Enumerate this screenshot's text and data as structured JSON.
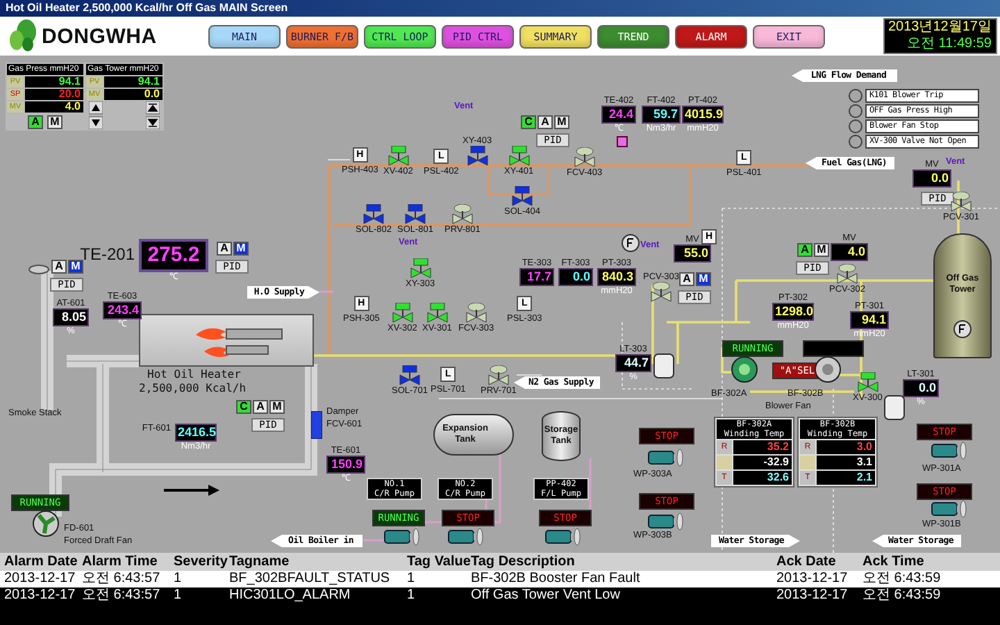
{
  "window": {
    "title": "Hot Oil Heater 2,500,000 Kcal/hr  Off Gas MAIN Screen"
  },
  "header": {
    "logo": "DONGWHA",
    "date": "2013년12월17일",
    "time": "오전 11:49:59",
    "nav": [
      {
        "label": "MAIN",
        "color": "#a8d8f8"
      },
      {
        "label": "BURNER F/B",
        "color": "#f07030"
      },
      {
        "label": "CTRL LOOP",
        "color": "#50e850"
      },
      {
        "label": "PID CTRL",
        "color": "#e050e0"
      },
      {
        "label": "SUMMARY",
        "color": "#f0e060"
      },
      {
        "label": "TREND",
        "color": "#3c8c30"
      },
      {
        "label": "ALARM",
        "color": "#c01818"
      },
      {
        "label": "EXIT",
        "color": "#f8b8d8"
      }
    ]
  },
  "faceplates": [
    {
      "title": "Gas Press",
      "unit": "mmH20",
      "rows": [
        {
          "label": "PV",
          "value": "94.1",
          "kind": "pv"
        },
        {
          "label": "SP",
          "value": "20.0",
          "kind": "sp"
        },
        {
          "label": "MV",
          "value": "4.0",
          "kind": "mv"
        }
      ],
      "modes": [
        {
          "label": "A",
          "selected": true
        },
        {
          "label": "M",
          "selected": false
        }
      ]
    },
    {
      "title": "Gas Tower",
      "unit": "mmH20",
      "rows": [
        {
          "label": "PV",
          "value": "94.1",
          "kind": "pv"
        },
        {
          "label": "MV",
          "value": "0.0",
          "kind": "mv"
        }
      ]
    }
  ],
  "diagram": {
    "readouts": [
      {
        "tag": "TE-402",
        "value": "24.4",
        "unit": "℃",
        "kind": "temperature"
      },
      {
        "tag": "FT-402",
        "value": "59.7",
        "unit": "Nm3/hr",
        "kind": "flow"
      },
      {
        "tag": "PT-402",
        "value": "4015.9",
        "unit": "mmH20",
        "kind": "pressure"
      },
      {
        "tag": "MV",
        "value": "0.0",
        "kind": "output"
      },
      {
        "tag": "MV",
        "value": "55.0",
        "kind": "output"
      },
      {
        "tag": "TE-303",
        "value": "17.7",
        "kind": "temperature"
      },
      {
        "tag": "FT-303",
        "value": "0.0",
        "kind": "flow"
      },
      {
        "tag": "PT-303",
        "value": "840.3",
        "unit": "mmH20",
        "kind": "pressure"
      },
      {
        "tag": "MV",
        "value": "4.0",
        "kind": "output"
      },
      {
        "tag": "PT-302",
        "value": "1298.0",
        "unit": "mmH20",
        "kind": "pressure"
      },
      {
        "tag": "PT-301",
        "value": "94.1",
        "unit": "mmH20",
        "kind": "pressure"
      },
      {
        "tag": "LT-303",
        "value": "44.7",
        "unit": "%",
        "kind": "level"
      },
      {
        "tag": "LT-301",
        "value": "0.0",
        "unit": "%",
        "kind": "level"
      },
      {
        "tag": "TE-201",
        "value": "275.2",
        "unit": "℃",
        "kind": "temperature"
      },
      {
        "tag": "AT-601",
        "value": "8.05",
        "unit": "%",
        "kind": "analyzer"
      },
      {
        "tag": "TE-603",
        "value": "243.4",
        "unit": "℃",
        "kind": "temperature"
      },
      {
        "tag": "FT-601",
        "value": "2416.5",
        "unit": "Nm3/hr",
        "kind": "flow"
      },
      {
        "tag": "TE-601",
        "value": "150.9",
        "unit": "℃",
        "kind": "temperature"
      }
    ],
    "mode_groups": [
      {
        "buttons": [
          {
            "label": "C",
            "selected": true
          },
          {
            "label": "A",
            "selected": false
          },
          {
            "label": "M",
            "selected": false
          }
        ],
        "pid": "PID"
      },
      {
        "buttons": [
          {
            "label": "A",
            "selected": true
          },
          {
            "label": "M",
            "selected": false
          }
        ],
        "pid": "PID"
      },
      {
        "buttons": [
          {
            "label": "A",
            "selected": false
          },
          {
            "label": "M",
            "selected": true
          }
        ],
        "pid": "PID"
      },
      {
        "buttons": [
          {
            "label": "A",
            "selected": false
          },
          {
            "label": "M",
            "selected": true
          }
        ],
        "pid": "PID"
      },
      {
        "buttons": [
          {
            "label": "A",
            "selected": false
          },
          {
            "label": "M",
            "selected": true
          }
        ],
        "pid": "PID"
      },
      {
        "buttons": [
          {
            "label": "C",
            "selected": true
          },
          {
            "label": "A",
            "selected": false
          },
          {
            "label": "M",
            "selected": false
          }
        ],
        "pid": "PID"
      },
      {
        "pid": "PID"
      }
    ],
    "lamps": [
      {
        "label": "RUNNING",
        "kind": "running"
      },
      {
        "label": "\"A\"SEL",
        "kind": "select"
      },
      {
        "label": "STOP",
        "kind": "stop"
      },
      {
        "label": "STOP",
        "kind": "stop"
      },
      {
        "label": "STOP",
        "kind": "stop"
      },
      {
        "label": "STOP",
        "kind": "stop"
      },
      {
        "label": "RUNNING",
        "kind": "running"
      },
      {
        "label": "RUNNING",
        "kind": "running"
      },
      {
        "label": "STOP",
        "kind": "stop"
      },
      {
        "label": "STOP",
        "kind": "stop"
      }
    ],
    "callouts": [
      {
        "label": "LNG Flow Demand",
        "kind": "left"
      },
      {
        "label": "Fuel Gas(LNG)",
        "kind": "left"
      },
      {
        "label": "H.O Supply",
        "kind": "right"
      },
      {
        "label": "N2 Gas Supply",
        "kind": "left"
      },
      {
        "label": "Oil Boiler in",
        "kind": "left"
      },
      {
        "label": "Water Storage",
        "kind": "right"
      },
      {
        "label": "Water Storage",
        "kind": "left"
      }
    ],
    "interlocks": [
      {
        "label": "K101 Blower Trip",
        "active": false
      },
      {
        "label": "OFF Gas Press High",
        "active": false
      },
      {
        "label": "Blower Fan Stop",
        "active": false
      },
      {
        "label": "XV-300 Valve Not Open",
        "active": false
      }
    ],
    "switches": [
      {
        "letter": "H",
        "tag": "PSH-403"
      },
      {
        "letter": "L",
        "tag": "PSL-402"
      },
      {
        "letter": "L",
        "tag": "PSL-401"
      },
      {
        "letter": "H"
      },
      {
        "letter": "H",
        "tag": "PSH-305"
      },
      {
        "letter": "L",
        "tag": "PSL-303"
      },
      {
        "letter": "L",
        "tag": "PSL-701"
      }
    ],
    "on_off_valves": [
      {
        "tag": "XY-403",
        "open": false
      },
      {
        "tag": "XV-402",
        "open": true
      },
      {
        "tag": "XY-401",
        "open": true
      },
      {
        "tag": "SOL-404",
        "open": false
      },
      {
        "tag": "SOL-802",
        "open": false
      },
      {
        "tag": "SOL-801",
        "open": false
      },
      {
        "tag": "XY-303",
        "open": true
      },
      {
        "tag": "XV-302",
        "open": true
      },
      {
        "tag": "XV-301",
        "open": true
      },
      {
        "tag": "SOL-701",
        "open": false
      },
      {
        "tag": "XV-300",
        "open": true
      }
    ],
    "control_valves": [
      {
        "tag": "FCV-403"
      },
      {
        "tag": "PRV-801"
      },
      {
        "tag": "PCV-301"
      },
      {
        "tag": "PCV-303"
      },
      {
        "tag": "PCV-302"
      },
      {
        "tag": "FCV-303"
      },
      {
        "tag": "PRV-701"
      }
    ],
    "labels": [
      {
        "text": "Vent",
        "kind": "vent"
      },
      {
        "text": "Vent",
        "kind": "vent"
      },
      {
        "text": "Vent",
        "kind": "vent"
      },
      {
        "text": "Vent",
        "kind": "vent"
      },
      {
        "text": "BF-302A",
        "kind": "tag"
      },
      {
        "text": "BF-302B",
        "kind": "tag"
      },
      {
        "text": "Blower Fan",
        "kind": "tag"
      },
      {
        "text": "WP-303A",
        "kind": "tag"
      },
      {
        "text": "WP-303B",
        "kind": "tag"
      },
      {
        "text": "WP-301A",
        "kind": "tag"
      },
      {
        "text": "WP-301B",
        "kind": "tag"
      },
      {
        "text": "Smoke Stack",
        "kind": "tag"
      },
      {
        "text": "Damper",
        "kind": "tag"
      },
      {
        "text": "FCV-601",
        "kind": "tag"
      },
      {
        "text": "FD-601",
        "kind": "tag"
      },
      {
        "text": "Forced Draft Fan",
        "kind": "tag"
      }
    ],
    "pump_labels": [
      {
        "lines": [
          "NO.1",
          "C/R Pump"
        ]
      },
      {
        "lines": [
          "NO.2",
          "C/R Pump"
        ]
      },
      {
        "lines": [
          "PP-402",
          "F/L Pump"
        ]
      }
    ],
    "heater": {
      "name": "Hot Oil Heater",
      "capacity": "2,500,000 Kcal/h"
    },
    "tanks": [
      {
        "kind": "expansion",
        "label": "Expansion Tank"
      },
      {
        "kind": "storage",
        "label": "Storage Tank"
      },
      {
        "kind": "tower",
        "label": "Off Gas Tower"
      }
    ],
    "winding_tables": [
      {
        "title": [
          "BF-302A",
          "Winding Temp"
        ],
        "rows": [
          {
            "label": "R",
            "value": "35.2",
            "kind": "r"
          },
          {
            "value": "-32.9",
            "kind": "s"
          },
          {
            "label": "T",
            "value": "32.6",
            "kind": "t"
          }
        ]
      },
      {
        "title": [
          "BF-302B",
          "Winding Temp"
        ],
        "rows": [
          {
            "label": "R",
            "value": "3.0",
            "kind": "r"
          },
          {
            "value": "3.1",
            "kind": "s"
          },
          {
            "label": "T",
            "value": "2.1",
            "kind": "t"
          }
        ]
      }
    ]
  },
  "alarms": {
    "columns": [
      "Alarm Date",
      "Alarm Time",
      "Severity",
      "Tagname",
      "Tag Value",
      "Tag Description",
      "Ack Date",
      "Ack Time"
    ],
    "rows": [
      {
        "selected": true,
        "cells": [
          "2013-12-17",
          "오전 6:43:57",
          "1",
          "BF_302BFAULT_STATUS",
          "1",
          "BF-302B Booster Fan Fault",
          "2013-12-17",
          "오전 6:43:59"
        ]
      },
      {
        "selected": false,
        "cells": [
          "2013-12-17",
          "오전 6:43:57",
          "1",
          "HIC301LO_ALARM",
          "1",
          "Off Gas Tower Vent Low",
          "2013-12-17",
          "오전 6:43:59"
        ]
      }
    ]
  }
}
